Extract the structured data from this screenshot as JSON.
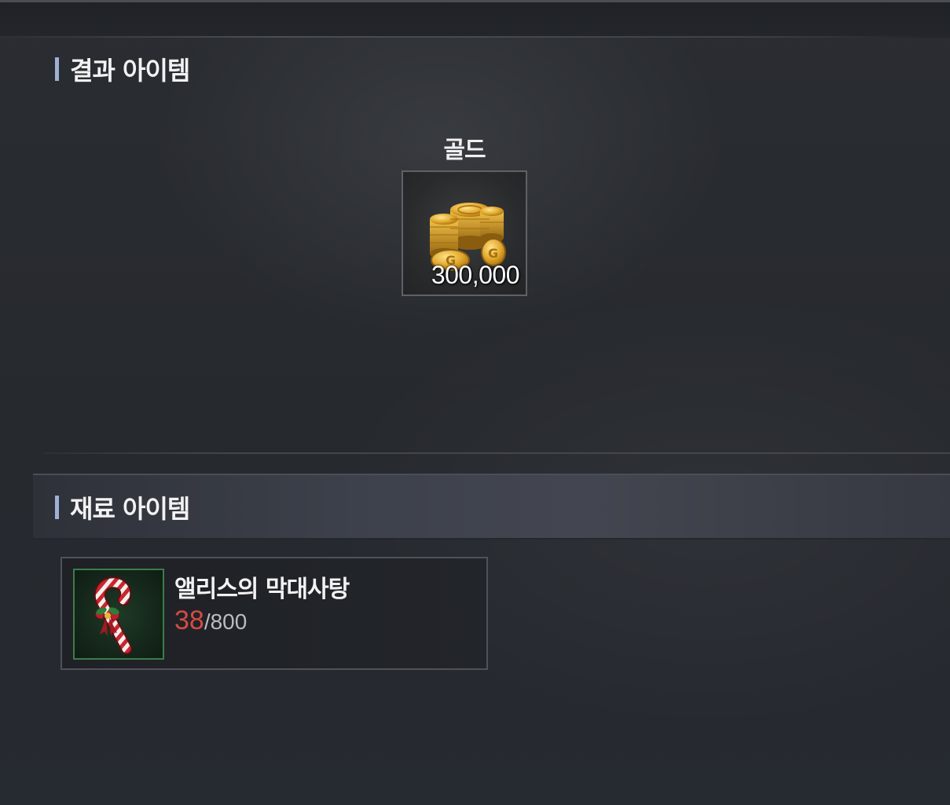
{
  "result_section": {
    "title": "결과 아이템",
    "item": {
      "name": "골드",
      "quantity": "300,000",
      "icon": "gold-coins-icon"
    }
  },
  "material_section": {
    "title": "재료 아이템",
    "items": [
      {
        "name": "앨리스의 막대사탕",
        "owned": "38",
        "separator": "/",
        "required": "800",
        "icon": "candy-cane-icon",
        "owned_color": "#d44b43"
      }
    ]
  },
  "colors": {
    "background": "#26292e",
    "title_bar_accent": "#9fb0d4",
    "candy_slot_border": "#3b7d49"
  }
}
